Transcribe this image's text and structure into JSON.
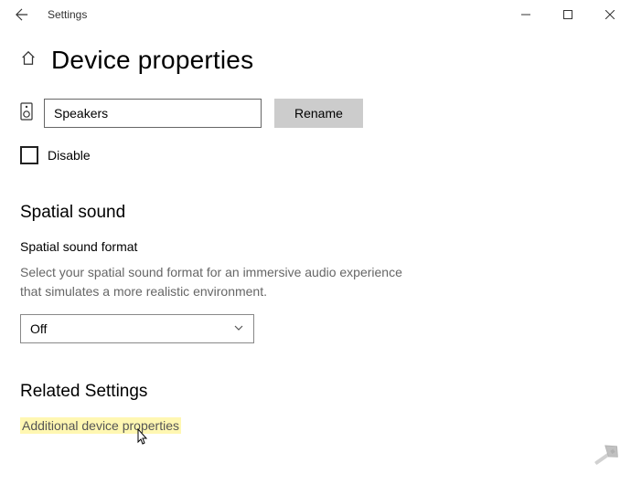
{
  "app": {
    "title": "Settings"
  },
  "page": {
    "title": "Device properties"
  },
  "device": {
    "name": "Speakers",
    "rename_label": "Rename",
    "disable_label": "Disable",
    "disable_checked": false
  },
  "spatial": {
    "heading": "Spatial sound",
    "format_label": "Spatial sound format",
    "help": "Select your spatial sound format for an immersive audio experience that simulates a more realistic environment.",
    "selected": "Off"
  },
  "related": {
    "heading": "Related Settings",
    "link": "Additional device properties"
  }
}
